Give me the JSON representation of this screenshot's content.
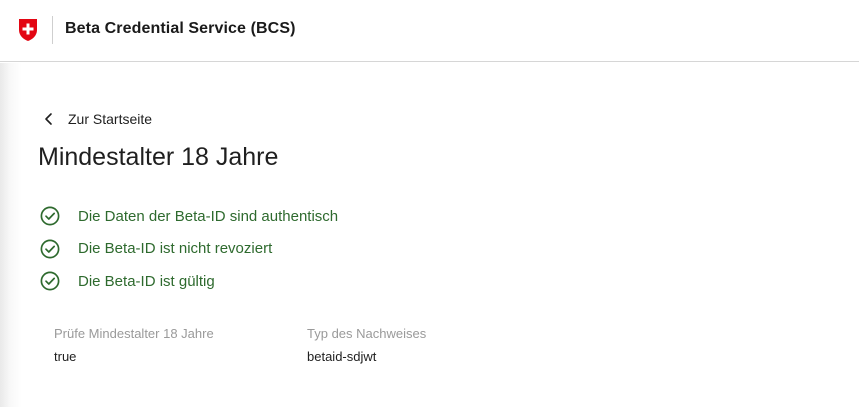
{
  "header": {
    "app_title": "Beta Credential Service (BCS)",
    "logo_icon": "swiss-shield-icon",
    "logo_color": "#e30613"
  },
  "nav": {
    "back_label": "Zur Startseite",
    "back_icon": "chevron-left-icon"
  },
  "main": {
    "title": "Mindestalter 18 Jahre",
    "success_color": "#2e6a2e",
    "checks": [
      {
        "icon": "check-circle-icon",
        "text": "Die Daten der Beta-ID sind authentisch"
      },
      {
        "icon": "check-circle-icon",
        "text": "Die Beta-ID ist nicht revoziert"
      },
      {
        "icon": "check-circle-icon",
        "text": "Die Beta-ID ist gültig"
      }
    ],
    "fields": [
      {
        "label": "Prüfe Mindestalter 18 Jahre",
        "value": "true"
      },
      {
        "label": "Typ des Nachweises",
        "value": "betaid-sdjwt"
      }
    ]
  }
}
